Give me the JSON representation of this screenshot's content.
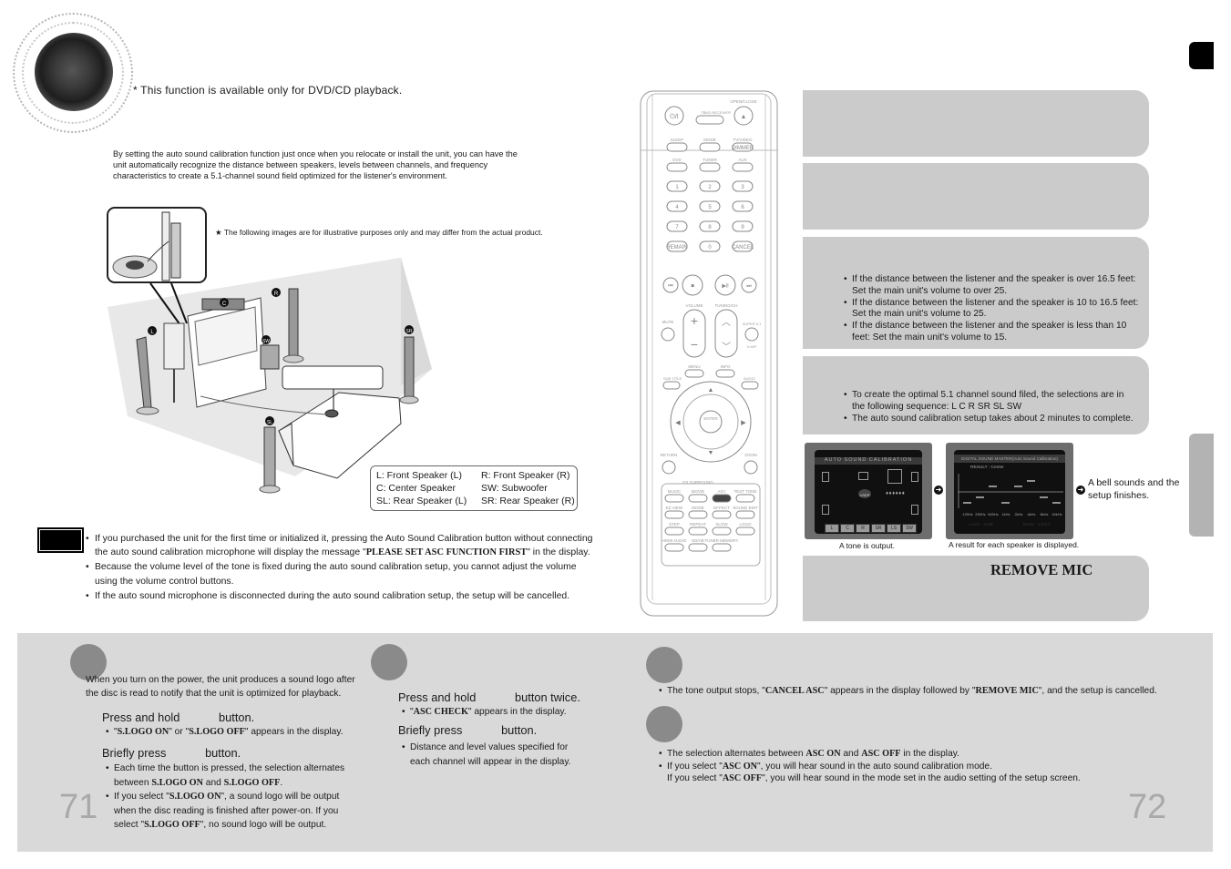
{
  "header": {
    "availability_note": "* This function is available only for DVD/CD playback.",
    "intro_text": "By setting the auto sound calibration function just once when you relocate or install the unit, you can have the unit automatically recognize the distance between speakers, levels between channels, and frequency characteristics to create a 5.1-channel sound field optimized for the listener's environment."
  },
  "diagram": {
    "illustrative_note": "The following images are for illustrative purposes only and may differ from the actual product.",
    "speaker_badges": [
      "L",
      "C",
      "R",
      "SW",
      "SR",
      "SL"
    ],
    "legend_left": [
      "L: Front Speaker (L)",
      "C: Center Speaker",
      "SL: Rear Speaker (L)"
    ],
    "legend_right": [
      "R: Front Speaker (R)",
      "SW: Subwoofer",
      "SR: Rear Speaker (R)"
    ]
  },
  "notes": {
    "items": [
      {
        "pre": "If you purchased the unit for the first time or initialized it, pressing the Auto Sound Calibration button without connecting the auto sound calibration microphone will display the message \"",
        "bold": "PLEASE SET ASC FUNCTION FIRST",
        "post": "\" in the display."
      },
      {
        "pre": "Because the volume level of the tone is fixed during the auto sound calibration setup, you cannot adjust the volume using the volume control buttons.",
        "bold": "",
        "post": ""
      },
      {
        "pre": "If the auto sound microphone is disconnected during the auto sound calibration setup, the setup will be cancelled.",
        "bold": "",
        "post": ""
      }
    ]
  },
  "remote": {
    "top_labels": {
      "open_close": "OPEN/CLOSE",
      "tv": "TV",
      "dvd_receiver": "DVD RECEIVER",
      "power": "⏻/I"
    },
    "row1": [
      "SLEEP",
      "MODE",
      "TV/VIDEO"
    ],
    "dimmer": "DIMMER",
    "row2": [
      "DVD",
      "TUNER",
      "AUX"
    ],
    "numbers": [
      "1",
      "2",
      "3",
      "4",
      "5",
      "6",
      "7",
      "8",
      "9"
    ],
    "row_bottom": [
      "REMAIN",
      "0",
      "CANCEL"
    ],
    "volume": "VOLUME",
    "tuning": "TUNING/CH",
    "mute": "MUTE",
    "super51": "SUPER 5.1",
    "vhup": "V-H/P",
    "menu": "MENU",
    "info": "INFO",
    "subtitle": "SUB TITLE",
    "audio": "AUDIO",
    "enter": "ENTER",
    "return": "RETURN",
    "zoom": "ZOOM",
    "ex_surround": "EX.SURROUND",
    "grid": [
      [
        "MUSIC",
        "MOVIE",
        "ASC",
        "TEST TONE"
      ],
      [
        "EZ VIEW",
        "MODE",
        "EFFECT",
        "SOUND EDIT"
      ],
      [
        "STEP",
        "REPEAT",
        "SLOW",
        "LOGO"
      ],
      [
        "HDMI AUDIO",
        "SD/HD",
        "TUNER MEMORY",
        ""
      ]
    ],
    "pl2_label": "PL II",
    "highlight_button": "ASC"
  },
  "steps_right": {
    "box3_items": [
      "If the distance between the listener and the speaker is over 16.5 feet: Set the main unit's volume to over 25.",
      "If the distance between the listener and the speaker is 10 to 16.5 feet: Set the main unit's volume to 25.",
      "If the distance between the listener and the speaker is less than 10 feet: Set the main unit's volume to 15."
    ],
    "box4_items": [
      "To create the optimal 5.1 channel sound filed, the selections are in the following sequence: L    C    R    SR    SL    SW",
      "The auto sound calibration setup takes about 2 minutes to complete."
    ],
    "screen1": {
      "title": "AUTO SOUND CALIBRATION",
      "user_label": "USER",
      "channels": [
        "L",
        "C",
        "R",
        "SR",
        "LS",
        "SW"
      ],
      "caption": "A tone is output."
    },
    "screen2": {
      "title": "DIGITAL SOUND MASTER(Auto Sound Calibration)",
      "result": "RESULT : Center",
      "freqs": [
        "125Hz",
        "250Hz",
        "500Hz",
        "1kHz",
        "2kHz",
        "4kHz",
        "8kHz",
        "16kHz"
      ],
      "levels": [
        -2,
        -1,
        1,
        -2,
        1,
        2,
        -1,
        -2
      ],
      "footer_level": "Level : 15dB",
      "footer_delay": "Delay : 3.5mS",
      "caption": "A result for each speaker is displayed."
    },
    "bell_text": "A bell sounds and the setup finishes.",
    "box5_display": "REMOVE MIC"
  },
  "bottom": {
    "logo_section": {
      "intro": "When you turn on the power, the unit produces a sound logo after the disc is read to notify that the unit is optimized for playback.",
      "step1": "Press and hold            button.",
      "step1_note": {
        "q1": "S.LOGO ON",
        "mid": "\" or \"",
        "q2": "S.LOGO OFF",
        "post": "\" appears in the display."
      },
      "step2": "Briefly press            button.",
      "step2_note1": {
        "pre": "Each time the button is pressed, the selection alternates between ",
        "b1": "S.LOGO ON",
        "mid": " and ",
        "b2": "S.LOGO OFF",
        "post": "."
      },
      "step2_note2": {
        "pre": "If you select \"",
        "b1": "S.LOGO ON",
        "mid": "\", a sound logo will be output when the disc reading is finished after power-on. If you select \"",
        "b2": "S.LOGO OFF",
        "post": "\", no sound logo will be output."
      }
    },
    "check_section": {
      "step1": "Press and hold            button twice.",
      "step1_note": {
        "bold": "ASC CHECK",
        "post": "\" appears in the display."
      },
      "step2": "Briefly press            button.",
      "step2_note": "Distance and level values specified for each channel will appear in the display."
    },
    "cancel_section": {
      "note": {
        "pre": "The tone output stops, \"",
        "b1": "CANCEL ASC",
        "mid": "\" appears in the display followed by \"",
        "b2": "REMOVE MIC",
        "post": "\", and the setup is cancelled."
      }
    },
    "onoff_section": {
      "note1": {
        "pre": "The selection alternates between ",
        "b1": "ASC ON",
        "mid": " and ",
        "b2": "ASC OFF",
        "post": " in the display."
      },
      "note2": {
        "pre": "If you select \"",
        "b1": "ASC ON",
        "post": "\", you will hear sound in the auto sound calibration mode."
      },
      "note3": {
        "pre": "If you select \"",
        "b1": "ASC OFF",
        "post": "\", you will hear sound  in the mode set in the audio setting of the setup screen."
      }
    },
    "page_left": "71",
    "page_right": "72"
  },
  "colors": {
    "step_box": "#cbcbcb",
    "bottom_band": "#d9d9d9",
    "circle": "#8a8a8a",
    "page_number": "#a9a9a9"
  }
}
